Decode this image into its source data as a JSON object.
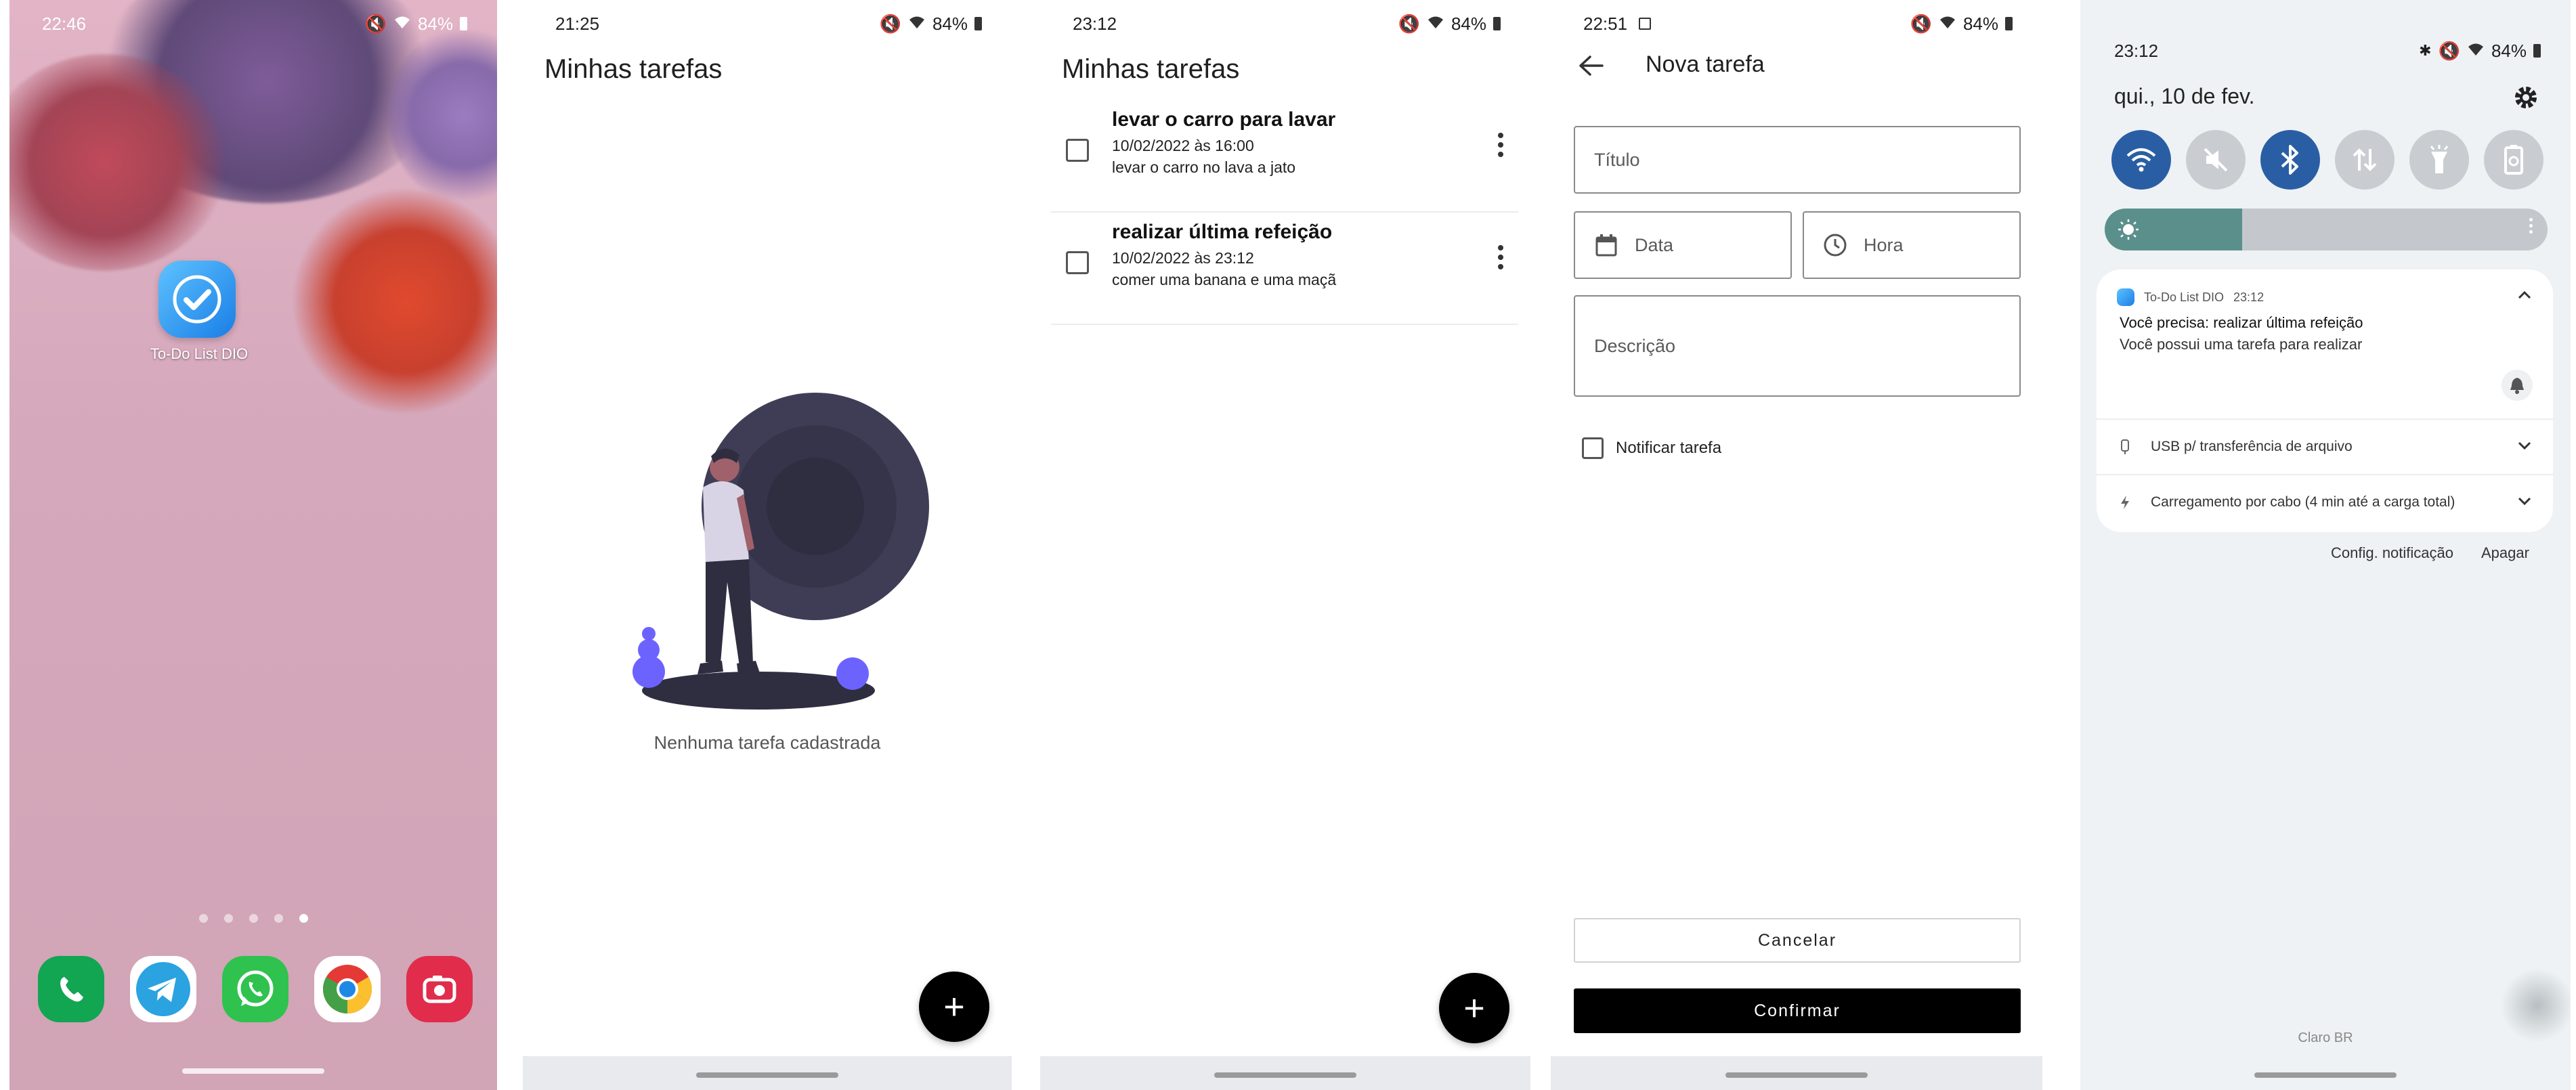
{
  "screen1": {
    "status_time": "22:46",
    "battery": "84%",
    "app_label": "To-Do List DIO",
    "page_dots": 5,
    "active_dot": 5,
    "dock_apps": [
      "phone-icon",
      "telegram-icon",
      "whatsapp-icon",
      "chrome-icon",
      "camera-icon"
    ]
  },
  "screen2": {
    "status_time": "21:25",
    "battery": "84%",
    "title": "Minhas tarefas",
    "empty_text": "Nenhuma tarefa cadastrada",
    "fab_label": "+"
  },
  "screen3": {
    "status_time": "23:12",
    "battery": "84%",
    "title": "Minhas tarefas",
    "fab_label": "+",
    "tasks": [
      {
        "title": "levar o carro para lavar",
        "datetime": "10/02/2022 às 16:00",
        "description": "levar o carro no lava a jato",
        "checked": false
      },
      {
        "title": "realizar última refeição",
        "datetime": "10/02/2022 às 23:12",
        "description": "comer uma banana e uma maçã",
        "checked": false
      }
    ]
  },
  "screen4": {
    "status_time": "22:51",
    "battery": "84%",
    "title": "Nova tarefa",
    "fields": {
      "titulo_placeholder": "Título",
      "data_placeholder": "Data",
      "hora_placeholder": "Hora",
      "descricao_placeholder": "Descrição"
    },
    "notify_label": "Notificar tarefa",
    "notify_checked": false,
    "cancel_label": "Cancelar",
    "confirm_label": "Confirmar"
  },
  "screen5": {
    "status_time": "23:12",
    "battery": "84%",
    "date": "qui., 10 de fev.",
    "brightness_level": 0.31,
    "quick_settings": [
      {
        "icon": "wifi-icon",
        "active": true
      },
      {
        "icon": "mute-icon",
        "active": false
      },
      {
        "icon": "bluetooth-icon",
        "active": true
      },
      {
        "icon": "data-transfer-icon",
        "active": false
      },
      {
        "icon": "flashlight-icon",
        "active": false
      },
      {
        "icon": "battery-saver-icon",
        "active": false
      }
    ],
    "notification": {
      "app": "To-Do List DIO",
      "time": "23:12",
      "title": "Você precisa: realizar última refeição",
      "body": "Você possui uma tarefa para realizar"
    },
    "system_rows": [
      "USB p/ transferência de arquivo",
      "Carregamento por cabo (4 min até a carga total)"
    ],
    "settings_link": "Config. notificação",
    "clear_link": "Apagar",
    "carrier": "Claro BR"
  },
  "colors": {
    "accent_blue": "#2a5ea4",
    "fab": "#000000",
    "confirm": "#000000",
    "brightness_fill": "#5b8f8c"
  }
}
